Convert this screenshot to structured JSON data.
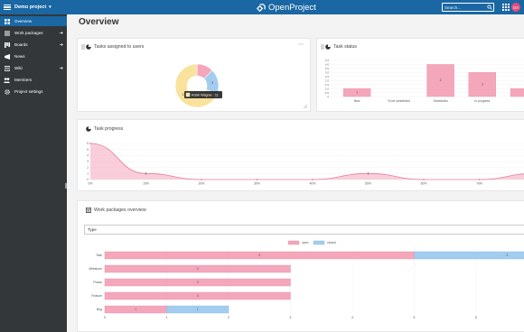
{
  "header": {
    "project_name": "Demo project",
    "logo_text": "OpenProject",
    "search_placeholder": "Search...",
    "avatar_initials": "OA"
  },
  "sidebar": {
    "items": [
      {
        "label": "Overview",
        "active": true,
        "has_arrow": false,
        "icon": "overview-icon"
      },
      {
        "label": "Work packages",
        "active": false,
        "has_arrow": true,
        "icon": "work-packages-icon"
      },
      {
        "label": "Boards",
        "active": false,
        "has_arrow": true,
        "icon": "boards-icon"
      },
      {
        "label": "News",
        "active": false,
        "has_arrow": false,
        "icon": "news-icon"
      },
      {
        "label": "Wiki",
        "active": false,
        "has_arrow": true,
        "icon": "wiki-icon"
      },
      {
        "label": "Members",
        "active": false,
        "has_arrow": false,
        "icon": "members-icon"
      },
      {
        "label": "Project settings",
        "active": false,
        "has_arrow": false,
        "icon": "settings-icon"
      }
    ]
  },
  "main": {
    "title": "Overview",
    "widgets": {
      "assigned": {
        "title": "Tasks assigned to users",
        "tooltip": "Robin Wagner : 11"
      },
      "status": {
        "title": "Task status"
      },
      "progress": {
        "title": "Task progress"
      },
      "overview": {
        "title": "Work packages overview",
        "group_by": "Type"
      }
    }
  },
  "colors": {
    "pink": "#f4a6bb",
    "blue": "#a3cdee",
    "yellow": "#f9e29c",
    "header": "#1a67a3",
    "sidebar": "#333739"
  },
  "chart_data": [
    {
      "type": "pie",
      "title": "Tasks assigned to users",
      "labels": [
        "Robin Wagner",
        "",
        ""
      ],
      "values": [
        11,
        2,
        3
      ],
      "colors": [
        "#f9e29c",
        "#f4a6bb",
        "#a3cdee"
      ],
      "data_labels": [
        "11",
        "",
        "3"
      ]
    },
    {
      "type": "bar",
      "title": "Task status",
      "categories": [
        "New",
        "To be scheduled",
        "Scheduled",
        "In progress",
        ""
      ],
      "values": [
        1,
        0,
        4,
        3,
        1
      ],
      "ylim": [
        0,
        4.5
      ],
      "yticks": [
        "0",
        "0.5",
        "1.0",
        "1.5",
        "2.0",
        "2.5",
        "3.0",
        "3.5",
        "4.0",
        "4.5"
      ],
      "data_labels": [
        "1",
        "",
        "4",
        "3",
        ""
      ]
    },
    {
      "type": "area",
      "title": "Task progress",
      "x": [
        "0%",
        "10%",
        "20%",
        "30%",
        "40%",
        "50%",
        "60%",
        "70%",
        "80%"
      ],
      "values": [
        6,
        1,
        0,
        0,
        0,
        1,
        0,
        0,
        1
      ],
      "ylim": [
        0,
        6
      ],
      "yticks": [
        "0",
        "1",
        "2",
        "3",
        "4",
        "5",
        "6"
      ],
      "data_labels": [
        "",
        "1",
        "",
        "",
        "",
        "1",
        "",
        "",
        ""
      ]
    },
    {
      "type": "bar",
      "orientation": "horizontal",
      "stacked": true,
      "title": "Work packages overview",
      "categories": [
        "Task",
        "Milestone",
        "Phase",
        "Feature",
        "Bug"
      ],
      "series": [
        {
          "name": "open",
          "values": [
            5,
            3,
            3,
            3,
            1
          ]
        },
        {
          "name": "closed",
          "values": [
            3,
            0,
            0,
            0,
            1
          ]
        }
      ],
      "xlim": [
        0,
        6.8
      ],
      "xticks": [
        "0",
        "1",
        "2",
        "3",
        "4",
        "5",
        "6"
      ],
      "data_labels": {
        "open": [
          "5",
          "3",
          "3",
          "3",
          "1"
        ],
        "closed": [
          "3",
          "",
          "",
          "",
          "1"
        ]
      }
    }
  ]
}
